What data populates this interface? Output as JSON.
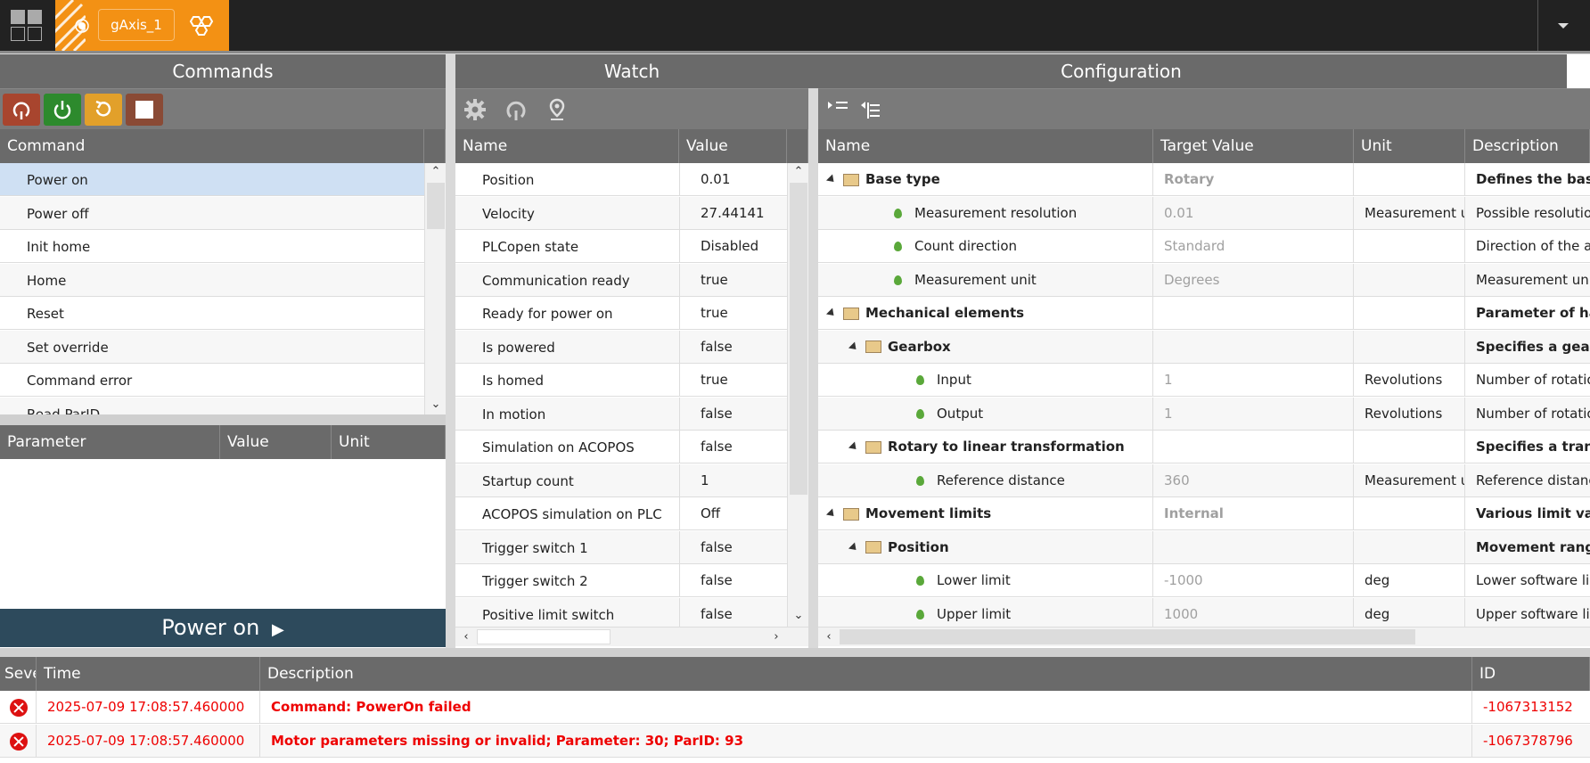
{
  "topbar": {
    "axis_tab_label": "gAxis_1"
  },
  "commands": {
    "title": "Commands",
    "column_header": "Command",
    "items": [
      "Power on",
      "Power off",
      "Init home",
      "Home",
      "Reset",
      "Set override",
      "Command error",
      "Read ParID"
    ],
    "selected": "Power on",
    "param_headers": {
      "parameter": "Parameter",
      "value": "Value",
      "unit": "Unit"
    },
    "execute_label": "Power on",
    "toolbar_icons": [
      "refresh-icon",
      "power-icon",
      "reset-icon",
      "stop-icon"
    ]
  },
  "watch": {
    "title": "Watch",
    "headers": {
      "name": "Name",
      "value": "Value"
    },
    "rows": [
      {
        "name": "Position",
        "value": "0.01"
      },
      {
        "name": "Velocity",
        "value": "27.44141"
      },
      {
        "name": "PLCopen state",
        "value": "Disabled"
      },
      {
        "name": "Communication ready",
        "value": "true"
      },
      {
        "name": "Ready for power on",
        "value": "true"
      },
      {
        "name": "Is powered",
        "value": "false"
      },
      {
        "name": "Is homed",
        "value": "true"
      },
      {
        "name": "In motion",
        "value": "false"
      },
      {
        "name": "Simulation on ACOPOS",
        "value": "false"
      },
      {
        "name": "Startup count",
        "value": "1"
      },
      {
        "name": "ACOPOS simulation on PLC",
        "value": "Off"
      },
      {
        "name": "Trigger switch 1",
        "value": "false"
      },
      {
        "name": "Trigger switch 2",
        "value": "false"
      },
      {
        "name": "Positive limit switch",
        "value": "false"
      }
    ]
  },
  "config": {
    "title": "Configuration",
    "headers": {
      "name": "Name",
      "target": "Target Value",
      "unit": "Unit",
      "description": "Description"
    },
    "rows": [
      {
        "level": 0,
        "type": "group",
        "name": "Base type",
        "target": "Rotary",
        "unit": "",
        "description": "Defines the basic m"
      },
      {
        "level": 1,
        "type": "leaf",
        "name": "Measurement resolution",
        "target": "0.01",
        "unit": "Measurement uni",
        "description": "Possible resolution"
      },
      {
        "level": 1,
        "type": "leaf",
        "name": "Count direction",
        "target": "Standard",
        "unit": "",
        "description": "Direction of the axi"
      },
      {
        "level": 1,
        "type": "leaf",
        "name": "Measurement unit",
        "target": "Degrees",
        "unit": "",
        "description": "Measurement unit f"
      },
      {
        "level": 0,
        "type": "group",
        "name": "Mechanical elements",
        "target": "",
        "unit": "",
        "description": "Parameter of hard"
      },
      {
        "level": 1,
        "type": "group",
        "name": "Gearbox",
        "target": "",
        "unit": "",
        "description": "Specifies a gearbo"
      },
      {
        "level": 2,
        "type": "leaf",
        "name": "Input",
        "target": "1",
        "unit": "Revolutions",
        "description": "Number of rotation"
      },
      {
        "level": 2,
        "type": "leaf",
        "name": "Output",
        "target": "1",
        "unit": "Revolutions",
        "description": "Number of rotation"
      },
      {
        "level": 1,
        "type": "group",
        "name": "Rotary to linear transformation",
        "target": "",
        "unit": "",
        "description": "Specifies a transfo"
      },
      {
        "level": 2,
        "type": "leaf",
        "name": "Reference distance",
        "target": "360",
        "unit": "Measurement uni",
        "description": "Reference distance"
      },
      {
        "level": 0,
        "type": "group",
        "name": "Movement limits",
        "target": "Internal",
        "unit": "",
        "description": "Various limit value"
      },
      {
        "level": 1,
        "type": "group",
        "name": "Position",
        "target": "",
        "unit": "",
        "description": "Movement range d"
      },
      {
        "level": 2,
        "type": "leaf",
        "name": "Lower limit",
        "target": "-1000",
        "unit": "deg",
        "description": "Lower software lim"
      },
      {
        "level": 2,
        "type": "leaf",
        "name": "Upper limit",
        "target": "1000",
        "unit": "deg",
        "description": "Upper software lim"
      }
    ]
  },
  "log": {
    "headers": {
      "severity": "Seve",
      "time": "Time",
      "description": "Description",
      "id": "ID"
    },
    "rows": [
      {
        "time": "2025-07-09 17:08:57.460000",
        "description": "Command: PowerOn failed",
        "id": "-1067313152"
      },
      {
        "time": "2025-07-09 17:08:57.460000",
        "description": "Motor parameters missing or invalid; Parameter: 30; ParID: 93",
        "id": "-1067378796"
      }
    ]
  },
  "colors": {
    "accent": "#f39114",
    "error": "#e00000",
    "header": "#6a6a6a",
    "selected_row": "#cfe0f3"
  }
}
